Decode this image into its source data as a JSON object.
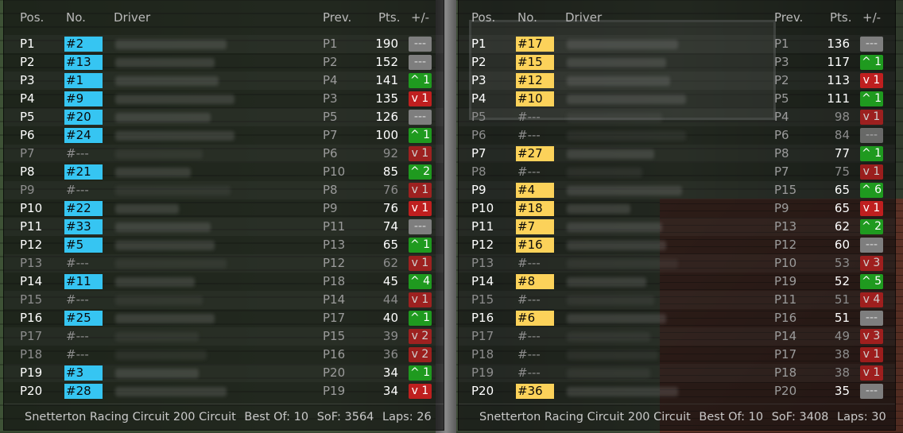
{
  "headers": {
    "pos": "Pos.",
    "no": "No.",
    "driver": "Driver",
    "prev": "Prev.",
    "pts": "Pts.",
    "delta": "+/-"
  },
  "colors": {
    "left_number_bg": "#36c5f2",
    "right_number_bg": "#fcd25a",
    "up": "#1f9a1f",
    "down": "#bf1f1f",
    "same": "#7e7e7e"
  },
  "left": {
    "rows": [
      {
        "pos": "P1",
        "num": "#2",
        "prev": "P1",
        "pts": "190",
        "delta": "---",
        "dir": "same",
        "dim": false
      },
      {
        "pos": "P2",
        "num": "#13",
        "prev": "P2",
        "pts": "152",
        "delta": "---",
        "dir": "same",
        "dim": false
      },
      {
        "pos": "P3",
        "num": "#1",
        "prev": "P4",
        "pts": "141",
        "delta": "^ 1",
        "dir": "up",
        "dim": false
      },
      {
        "pos": "P4",
        "num": "#9",
        "prev": "P3",
        "pts": "135",
        "delta": "v 1",
        "dir": "down",
        "dim": false
      },
      {
        "pos": "P5",
        "num": "#20",
        "prev": "P5",
        "pts": "126",
        "delta": "---",
        "dir": "same",
        "dim": false
      },
      {
        "pos": "P6",
        "num": "#24",
        "prev": "P7",
        "pts": "100",
        "delta": "^ 1",
        "dir": "up",
        "dim": false
      },
      {
        "pos": "P7",
        "num": "#---",
        "prev": "P6",
        "pts": "92",
        "delta": "v 1",
        "dir": "down",
        "dim": true
      },
      {
        "pos": "P8",
        "num": "#21",
        "prev": "P10",
        "pts": "85",
        "delta": "^ 2",
        "dir": "up",
        "dim": false
      },
      {
        "pos": "P9",
        "num": "#---",
        "prev": "P8",
        "pts": "76",
        "delta": "v 1",
        "dir": "down",
        "dim": true
      },
      {
        "pos": "P10",
        "num": "#22",
        "prev": "P9",
        "pts": "76",
        "delta": "v 1",
        "dir": "down",
        "dim": false
      },
      {
        "pos": "P11",
        "num": "#33",
        "prev": "P11",
        "pts": "74",
        "delta": "---",
        "dir": "same",
        "dim": false
      },
      {
        "pos": "P12",
        "num": "#5",
        "prev": "P13",
        "pts": "65",
        "delta": "^ 1",
        "dir": "up",
        "dim": false
      },
      {
        "pos": "P13",
        "num": "#---",
        "prev": "P12",
        "pts": "62",
        "delta": "v 1",
        "dir": "down",
        "dim": true
      },
      {
        "pos": "P14",
        "num": "#11",
        "prev": "P18",
        "pts": "45",
        "delta": "^ 4",
        "dir": "up",
        "dim": false
      },
      {
        "pos": "P15",
        "num": "#---",
        "prev": "P14",
        "pts": "44",
        "delta": "v 1",
        "dir": "down",
        "dim": true
      },
      {
        "pos": "P16",
        "num": "#25",
        "prev": "P17",
        "pts": "40",
        "delta": "^ 1",
        "dir": "up",
        "dim": false
      },
      {
        "pos": "P17",
        "num": "#---",
        "prev": "P15",
        "pts": "39",
        "delta": "v 2",
        "dir": "down",
        "dim": true
      },
      {
        "pos": "P18",
        "num": "#---",
        "prev": "P16",
        "pts": "36",
        "delta": "v 2",
        "dir": "down",
        "dim": true
      },
      {
        "pos": "P19",
        "num": "#3",
        "prev": "P20",
        "pts": "34",
        "delta": "^ 1",
        "dir": "up",
        "dim": false
      },
      {
        "pos": "P20",
        "num": "#28",
        "prev": "P19",
        "pts": "34",
        "delta": "v 1",
        "dir": "down",
        "dim": false
      }
    ],
    "footer": {
      "track": "Snetterton Racing Circuit 200 Circuit",
      "best": "Best Of: 10",
      "sof": "SoF: 3564",
      "laps": "Laps: 26"
    }
  },
  "right": {
    "rows": [
      {
        "pos": "P1",
        "num": "#17",
        "prev": "P1",
        "pts": "136",
        "delta": "---",
        "dir": "same",
        "dim": false
      },
      {
        "pos": "P2",
        "num": "#15",
        "prev": "P3",
        "pts": "117",
        "delta": "^ 1",
        "dir": "up",
        "dim": false
      },
      {
        "pos": "P3",
        "num": "#12",
        "prev": "P2",
        "pts": "113",
        "delta": "v 1",
        "dir": "down",
        "dim": false
      },
      {
        "pos": "P4",
        "num": "#10",
        "prev": "P5",
        "pts": "111",
        "delta": "^ 1",
        "dir": "up",
        "dim": false
      },
      {
        "pos": "P5",
        "num": "#---",
        "prev": "P4",
        "pts": "98",
        "delta": "v 1",
        "dir": "down",
        "dim": true
      },
      {
        "pos": "P6",
        "num": "#---",
        "prev": "P6",
        "pts": "84",
        "delta": "---",
        "dir": "same",
        "dim": true
      },
      {
        "pos": "P7",
        "num": "#27",
        "prev": "P8",
        "pts": "77",
        "delta": "^ 1",
        "dir": "up",
        "dim": false
      },
      {
        "pos": "P8",
        "num": "#---",
        "prev": "P7",
        "pts": "75",
        "delta": "v 1",
        "dir": "down",
        "dim": true
      },
      {
        "pos": "P9",
        "num": "#4",
        "prev": "P15",
        "pts": "65",
        "delta": "^ 6",
        "dir": "up",
        "dim": false
      },
      {
        "pos": "P10",
        "num": "#18",
        "prev": "P9",
        "pts": "65",
        "delta": "v 1",
        "dir": "down",
        "dim": false
      },
      {
        "pos": "P11",
        "num": "#7",
        "prev": "P13",
        "pts": "62",
        "delta": "^ 2",
        "dir": "up",
        "dim": false
      },
      {
        "pos": "P12",
        "num": "#16",
        "prev": "P12",
        "pts": "60",
        "delta": "---",
        "dir": "same",
        "dim": false
      },
      {
        "pos": "P13",
        "num": "#---",
        "prev": "P10",
        "pts": "53",
        "delta": "v 3",
        "dir": "down",
        "dim": true
      },
      {
        "pos": "P14",
        "num": "#8",
        "prev": "P19",
        "pts": "52",
        "delta": "^ 5",
        "dir": "up",
        "dim": false
      },
      {
        "pos": "P15",
        "num": "#---",
        "prev": "P11",
        "pts": "51",
        "delta": "v 4",
        "dir": "down",
        "dim": true
      },
      {
        "pos": "P16",
        "num": "#6",
        "prev": "P16",
        "pts": "51",
        "delta": "---",
        "dir": "same",
        "dim": false
      },
      {
        "pos": "P17",
        "num": "#---",
        "prev": "P14",
        "pts": "49",
        "delta": "v 3",
        "dir": "down",
        "dim": true
      },
      {
        "pos": "P18",
        "num": "#---",
        "prev": "P17",
        "pts": "38",
        "delta": "v 1",
        "dir": "down",
        "dim": true
      },
      {
        "pos": "P19",
        "num": "#---",
        "prev": "P18",
        "pts": "38",
        "delta": "v 1",
        "dir": "down",
        "dim": true
      },
      {
        "pos": "P20",
        "num": "#36",
        "prev": "P20",
        "pts": "35",
        "delta": "---",
        "dir": "same",
        "dim": false
      }
    ],
    "footer": {
      "track": "Snetterton Racing Circuit 200 Circuit",
      "best": "Best Of: 10",
      "sof": "SoF: 3408",
      "laps": "Laps: 30"
    }
  }
}
